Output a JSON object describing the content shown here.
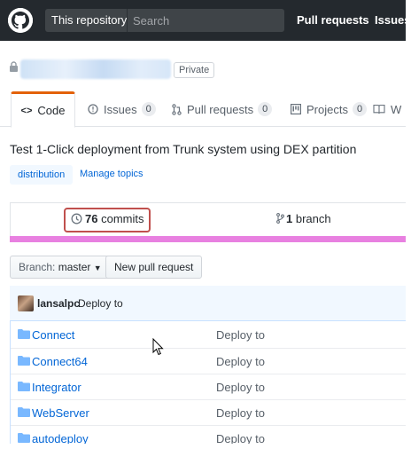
{
  "header": {
    "scope_label": "This repository",
    "search_placeholder": "Search",
    "nav": [
      "Pull requests",
      "Issues"
    ]
  },
  "repo": {
    "visibility": "Private"
  },
  "tabs": [
    {
      "label": "Code",
      "icon": "code-icon"
    },
    {
      "label": "Issues",
      "count": "0",
      "icon": "issue-icon"
    },
    {
      "label": "Pull requests",
      "count": "0",
      "icon": "pull-request-icon"
    },
    {
      "label": "Projects",
      "count": "0",
      "icon": "project-icon"
    },
    {
      "label": "W",
      "icon": "wiki-icon"
    }
  ],
  "description": "Test 1-Click deployment from Trunk system using DEX partition",
  "topics": [
    "distribution"
  ],
  "manage_topics": "Manage topics",
  "summary": {
    "commits_count": "76",
    "commits_label": "commits",
    "branch_count": "1",
    "branch_label": "branch"
  },
  "branch_button": {
    "prefix": "Branch:",
    "value": "master"
  },
  "new_pr_button": "New pull request",
  "latest_commit": {
    "author": "lansalpc",
    "message": "Deploy to"
  },
  "files": [
    {
      "name": "Connect",
      "message": "Deploy to"
    },
    {
      "name": "Connect64",
      "message": "Deploy to"
    },
    {
      "name": "Integrator",
      "message": "Deploy to"
    },
    {
      "name": "WebServer",
      "message": "Deploy to"
    },
    {
      "name": "autodeploy",
      "message": "Deploy to"
    }
  ],
  "colors": {
    "header_bg": "#24292e",
    "link": "#0366d6",
    "tab_accent": "#e36209",
    "highlight_box": "#c0504d",
    "language_bar": "#e880e0"
  }
}
